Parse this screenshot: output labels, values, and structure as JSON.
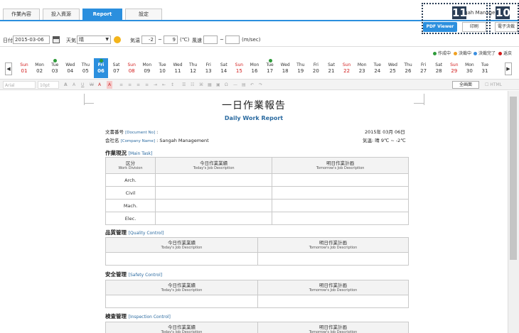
{
  "tabs": [
    {
      "label": "作業內容"
    },
    {
      "label": "投入資源"
    },
    {
      "label": "Report"
    },
    {
      "label": "設定"
    }
  ],
  "header": {
    "company_name": "Sangah Management",
    "pdf_button": "PDF Viewer",
    "print_button": "印刷",
    "esign_button": "電子決裁",
    "badge_11": "11",
    "badge_10": "10"
  },
  "filter": {
    "date_label": "日付",
    "date_value": "2015-03-06",
    "weather_label": "天気",
    "weather_value": "晴",
    "temp_label": "気温",
    "temp_min": "-2",
    "temp_tilde": "~",
    "temp_max": "9",
    "temp_unit": "(℃)",
    "wind_label": "風速",
    "wind_min": "",
    "wind_tilde": "~",
    "wind_max": "",
    "wind_unit": "(m/sec)"
  },
  "legend": [
    {
      "label": "作成中",
      "color": "#2e9b3a"
    },
    {
      "label": "決裁中",
      "color": "#f0a020"
    },
    {
      "label": "決裁完了",
      "color": "#3a8ee0"
    },
    {
      "label": "返戻",
      "color": "#d21c1c"
    }
  ],
  "calendar": {
    "prev": "◀",
    "next": "▶",
    "days": [
      {
        "wd": "Sun",
        "d": "01",
        "sun": true
      },
      {
        "wd": "Mon",
        "d": "02"
      },
      {
        "wd": "Tue",
        "d": "03",
        "mark": true
      },
      {
        "wd": "Wed",
        "d": "04"
      },
      {
        "wd": "Thu",
        "d": "05"
      },
      {
        "wd": "Fri",
        "d": "06",
        "sel": true,
        "mark": true
      },
      {
        "wd": "Sat",
        "d": "07"
      },
      {
        "wd": "Sun",
        "d": "08",
        "sun": true
      },
      {
        "wd": "Mon",
        "d": "09"
      },
      {
        "wd": "Tue",
        "d": "10"
      },
      {
        "wd": "Wed",
        "d": "11"
      },
      {
        "wd": "Thu",
        "d": "12"
      },
      {
        "wd": "Fri",
        "d": "13"
      },
      {
        "wd": "Sat",
        "d": "14"
      },
      {
        "wd": "Sun",
        "d": "15",
        "sun": true
      },
      {
        "wd": "Mon",
        "d": "16"
      },
      {
        "wd": "Tue",
        "d": "17",
        "mark": true
      },
      {
        "wd": "Wed",
        "d": "18"
      },
      {
        "wd": "Thu",
        "d": "19"
      },
      {
        "wd": "Fri",
        "d": "20"
      },
      {
        "wd": "Sat",
        "d": "21"
      },
      {
        "wd": "Sun",
        "d": "22",
        "sun": true
      },
      {
        "wd": "Mon",
        "d": "23"
      },
      {
        "wd": "Tue",
        "d": "24"
      },
      {
        "wd": "Wed",
        "d": "25"
      },
      {
        "wd": "Thu",
        "d": "26"
      },
      {
        "wd": "Fri",
        "d": "27"
      },
      {
        "wd": "Sat",
        "d": "28"
      },
      {
        "wd": "Sun",
        "d": "29",
        "sun": true
      },
      {
        "wd": "Mon",
        "d": "30"
      },
      {
        "wd": "Tue",
        "d": "31"
      }
    ]
  },
  "toolbar": {
    "font": "Arial",
    "size": "10pt",
    "fullscreen": "全画面",
    "html": "HTML"
  },
  "document": {
    "title": "一日作業報告",
    "subtitle": "Daily Work Report",
    "doc_no_label": "文書番号",
    "doc_no_en": "[Document No]",
    "doc_no_colon": ":",
    "company_label": "会社名",
    "company_en": "[Company Name]",
    "company_value": ": Sangah Management",
    "date_text": "2015年  03月  06日",
    "weather_text": "気温: 晴  9℃  ~  -2℃",
    "main_task": {
      "title": "作業現況",
      "en": "[Main Task]"
    },
    "quality": {
      "title": "品質管理",
      "en": "[Quality Control]"
    },
    "safety": {
      "title": "安全管理",
      "en": "[Safety Control]"
    },
    "inspection": {
      "title": "検査管理",
      "en": "[Inspection Control]"
    },
    "col_division": "区分",
    "col_division_en": "Work Division",
    "col_today": "今日作業業績",
    "col_today_en": "Today's Job Description",
    "col_tomorrow": "明日作業計画",
    "col_tomorrow_en": "Tomorrow's Job Description",
    "divisions": [
      "Arch.",
      "Civil",
      "Mach.",
      "Elec."
    ]
  }
}
